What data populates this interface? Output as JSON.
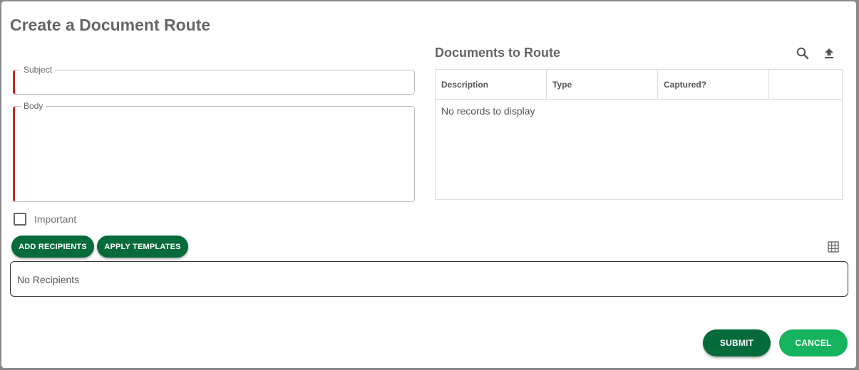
{
  "dialog": {
    "title": "Create a Document Route"
  },
  "form": {
    "subject_label": "Subject",
    "subject_value": "",
    "body_label": "Body",
    "body_value": "",
    "important_label": "Important",
    "important_checked": false,
    "required_color": "#c62828"
  },
  "recipients": {
    "add_label": "ADD RECIPIENTS",
    "apply_templates_label": "APPLY TEMPLATES",
    "empty_text": "No Recipients",
    "grid_icon": "grid-icon"
  },
  "documents": {
    "title": "Documents to Route",
    "search_icon": "search-icon",
    "upload_icon": "upload-icon",
    "columns": [
      "Description",
      "Type",
      "Captured?",
      ""
    ],
    "empty_text": "No records to display"
  },
  "actions": {
    "submit_label": "SUBMIT",
    "cancel_label": "CANCEL",
    "primary_color": "#066b3b",
    "secondary_color": "#16b35e"
  }
}
